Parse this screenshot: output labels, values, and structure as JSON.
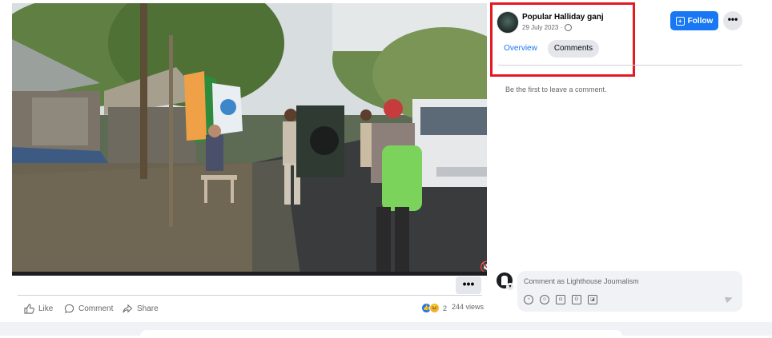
{
  "post": {
    "page_name": "Popular Halliday ganj",
    "date": "29 July 2023 ·",
    "follow_label": "Follow",
    "more_label": "•••"
  },
  "tabs": [
    {
      "label": "Overview",
      "active": true
    },
    {
      "label": "Comments",
      "active": false
    }
  ],
  "comments": {
    "empty_text": "Be the first to leave a comment.",
    "input_placeholder": "Comment as Lighthouse Journalism"
  },
  "video": {
    "more_label": "•••",
    "mute_icon": "speaker-muted-icon"
  },
  "actions": {
    "like_label": "Like",
    "comment_label": "Comment",
    "share_label": "Share"
  },
  "stats": {
    "reaction_count": "2",
    "views": "244 views"
  },
  "colors": {
    "accent": "#1877f2",
    "highlight_box": "#e31a22",
    "chip_bg": "#e4e6eb"
  }
}
